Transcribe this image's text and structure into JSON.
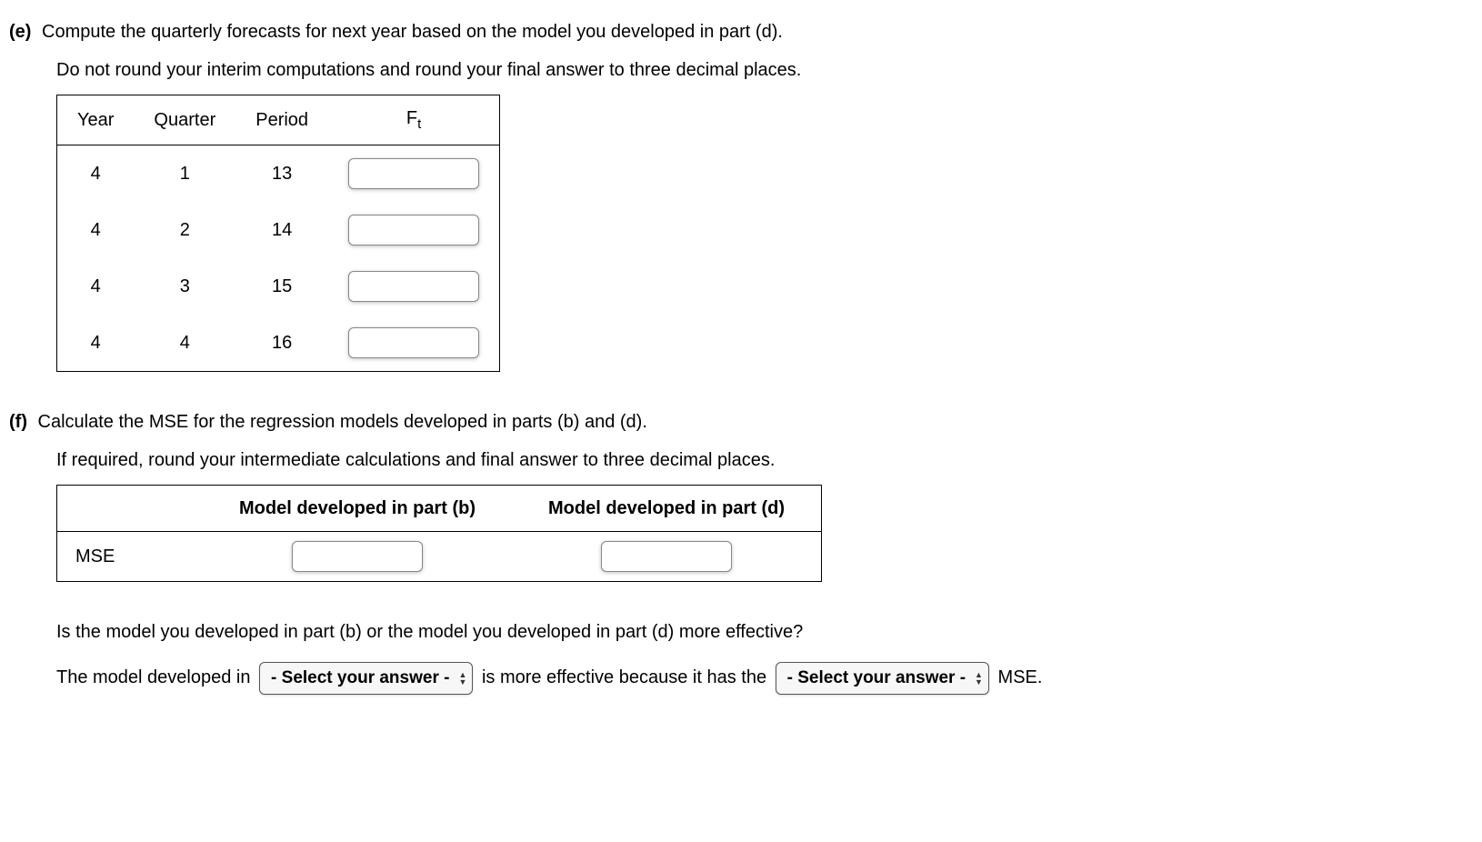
{
  "partE": {
    "label": "(e)",
    "line1": "Compute the quarterly forecasts for next year based on the model you developed in part (d).",
    "line2": "Do not round your interim computations and round your final answer to three decimal places.",
    "headers": {
      "year": "Year",
      "quarter": "Quarter",
      "period": "Period",
      "ft_base": "F",
      "ft_sub": "t"
    },
    "rows": [
      {
        "year": "4",
        "quarter": "1",
        "period": "13",
        "ft": ""
      },
      {
        "year": "4",
        "quarter": "2",
        "period": "14",
        "ft": ""
      },
      {
        "year": "4",
        "quarter": "3",
        "period": "15",
        "ft": ""
      },
      {
        "year": "4",
        "quarter": "4",
        "period": "16",
        "ft": ""
      }
    ]
  },
  "partF": {
    "label": "(f)",
    "line1": "Calculate the MSE for the regression models developed in parts (b) and (d).",
    "line2": "If required, round your intermediate calculations and final answer to three decimal places.",
    "headers": {
      "blank": "",
      "colB": "Model developed in part (b)",
      "colD": "Model developed in part (d)"
    },
    "rowLabel": "MSE",
    "valueB": "",
    "valueD": "",
    "question": "Is the model you developed in part (b) or the model you developed in part (d) more effective?",
    "sentence_pre": "The model developed in ",
    "sel1_placeholder": "- Select your answer -",
    "sentence_mid": " is more effective because it has the ",
    "sel2_placeholder": "- Select your answer -",
    "sentence_post": " MSE."
  }
}
